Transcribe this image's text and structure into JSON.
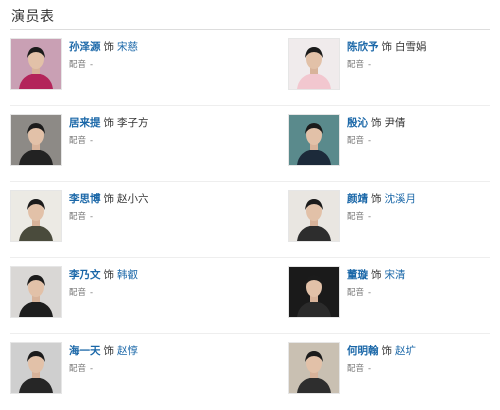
{
  "section": {
    "title": "演员表"
  },
  "cast": [
    [
      {
        "actor": "孙泽源",
        "as": "饰",
        "role": "宋慈",
        "role_is_link": true,
        "dub_label": "配音",
        "dub_value": "-",
        "photo_bg": "#c9a0b4",
        "shirt": "#b3245a"
      },
      {
        "actor": "陈欣予",
        "as": "饰",
        "role": "白雪娟",
        "role_is_link": false,
        "dub_label": "配音",
        "dub_value": "-",
        "photo_bg": "#f0ebec",
        "shirt": "#f2c7cf"
      }
    ],
    [
      {
        "actor": "居来提",
        "as": "饰",
        "role": "李子方",
        "role_is_link": false,
        "dub_label": "配音",
        "dub_value": "-",
        "photo_bg": "#8d8a86",
        "shirt": "#222222"
      },
      {
        "actor": "殷沁",
        "as": "饰",
        "role": "尹倩",
        "role_is_link": false,
        "dub_label": "配音",
        "dub_value": "-",
        "photo_bg": "#5a8a8c",
        "shirt": "#1c2a3a"
      }
    ],
    [
      {
        "actor": "李思博",
        "as": "饰",
        "role": "赵小六",
        "role_is_link": false,
        "dub_label": "配音",
        "dub_value": "-",
        "photo_bg": "#eceae4",
        "shirt": "#4a4b3c"
      },
      {
        "actor": "颜靖",
        "as": "饰",
        "role": "沈溪月",
        "role_is_link": true,
        "dub_label": "配音",
        "dub_value": "-",
        "photo_bg": "#e9e6e1",
        "shirt": "#2d2d2d"
      }
    ],
    [
      {
        "actor": "李乃文",
        "as": "饰",
        "role": "韩叡",
        "role_is_link": true,
        "dub_label": "配音",
        "dub_value": "-",
        "photo_bg": "#d9d7d5",
        "shirt": "#1e1e1e"
      },
      {
        "actor": "董璇",
        "as": "饰",
        "role": "宋清",
        "role_is_link": true,
        "dub_label": "配音",
        "dub_value": "-",
        "photo_bg": "#1a1a1a",
        "shirt": "#2b2b2b"
      }
    ],
    [
      {
        "actor": "海一天",
        "as": "饰",
        "role": "赵惇",
        "role_is_link": true,
        "dub_label": "配音",
        "dub_value": "-",
        "photo_bg": "#cfcfcf",
        "shirt": "#262626"
      },
      {
        "actor": "何明翰",
        "as": "饰",
        "role": "赵圹",
        "role_is_link": true,
        "dub_label": "配音",
        "dub_value": "-",
        "photo_bg": "#c9c0b2",
        "shirt": "#2e2e2e"
      }
    ]
  ]
}
